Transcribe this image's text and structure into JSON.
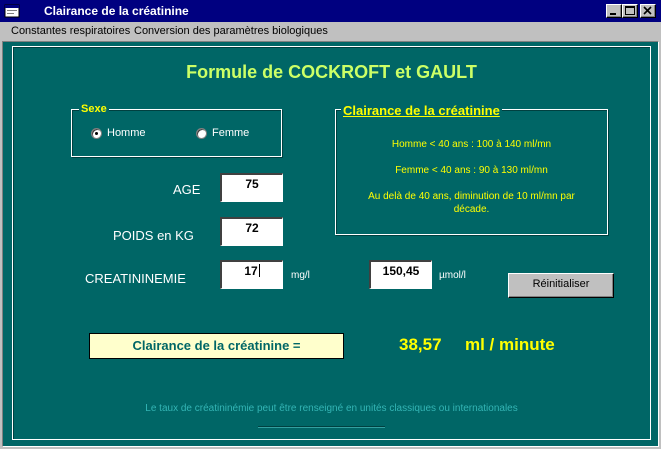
{
  "window": {
    "title": "Clairance de la créatinine",
    "icon": "app-icon",
    "buttons": [
      "minimize",
      "maximize",
      "close"
    ]
  },
  "menu": {
    "items": [
      "Constantes respiratoires",
      "Conversion des paramètres biologiques"
    ]
  },
  "main": {
    "heading": "Formule de COCKROFT et GAULT",
    "sexe": {
      "legend": "Sexe",
      "options": [
        "Homme",
        "Femme"
      ],
      "selected": "Homme"
    },
    "reference": {
      "legend": "Clairance de la créatinine",
      "lines": [
        "Homme  <  40 ans : 100 à 140 ml/mn",
        "Femme < 40 ans : 90 à 130 ml/mn",
        "Au delà de 40 ans, diminution de 10 ml/mn par décade."
      ]
    },
    "fields": {
      "age_label": "AGE",
      "age_value": "75",
      "poids_label": "POIDS en KG",
      "poids_value": "72",
      "creat_label": "CREATININEMIE",
      "creat_value": "17",
      "creat_unit": "mg/l",
      "umol_value": "150,45",
      "umol_unit": "µmol/l"
    },
    "reset_label": "Réinitialiser",
    "result": {
      "label": "Clairance de la créatinine =",
      "value": "38,57",
      "unit": "ml / minute"
    },
    "footnote": "Le taux de créatininémie peut être renseigné en unités classiques ou internationales"
  },
  "colors": {
    "background": "#006666",
    "accent_yellow": "#ffff00",
    "heading_green": "#ccff66",
    "result_box": "#ffffcc",
    "titlebar": "#000080"
  }
}
